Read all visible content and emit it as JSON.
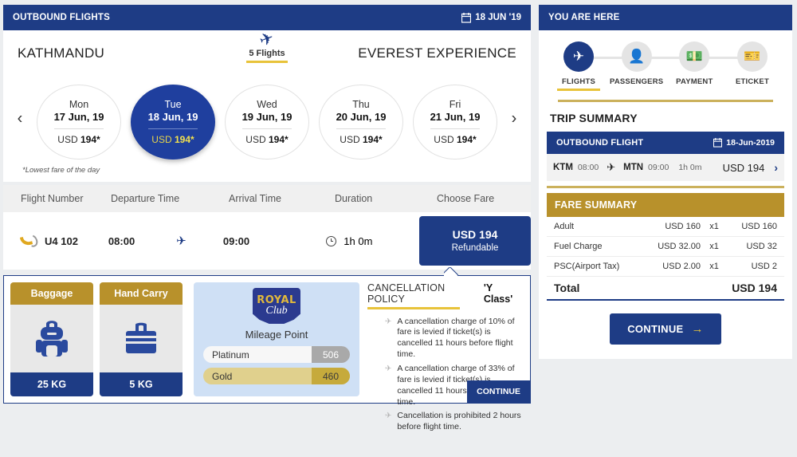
{
  "outbound": {
    "header_title": "OUTBOUND FLIGHTS",
    "header_date": "18 JUN '19",
    "calendar_icon": "calendar-icon",
    "origin": "KATHMANDU",
    "destination": "EVEREST EXPERIENCE",
    "flights_count": "5 Flights",
    "plane_icon": "airplane-icon",
    "prev_arrow": "‹",
    "next_arrow": "›",
    "lowest_fare_note": "*Lowest fare of the day",
    "days": [
      {
        "dow": "Mon",
        "date": "17 Jun, 19",
        "currency": "USD",
        "price": "194*",
        "selected": false
      },
      {
        "dow": "Tue",
        "date": "18 Jun, 19",
        "currency": "USD",
        "price": "194*",
        "selected": true
      },
      {
        "dow": "Wed",
        "date": "19 Jun, 19",
        "currency": "USD",
        "price": "194*",
        "selected": false
      },
      {
        "dow": "Thu",
        "date": "20 Jun, 19",
        "currency": "USD",
        "price": "194*",
        "selected": false
      },
      {
        "dow": "Fri",
        "date": "21 Jun, 19",
        "currency": "USD",
        "price": "194*",
        "selected": false
      }
    ]
  },
  "flight_table": {
    "columns": [
      "Flight Number",
      "Departure Time",
      "Arrival Time",
      "Duration",
      "Choose Fare"
    ],
    "row": {
      "flight_number": "U4 102",
      "departure_time": "08:00",
      "arrival_time": "09:00",
      "duration": "1h 0m",
      "fare_amount": "USD 194",
      "fare_type": "Refundable"
    }
  },
  "details": {
    "baggage": {
      "title": "Baggage",
      "weight": "25 KG",
      "icon": "backpack-icon"
    },
    "hand_carry": {
      "title": "Hand Carry",
      "weight": "5 KG",
      "icon": "briefcase-icon"
    },
    "mileage": {
      "logo_top": "ROYAL",
      "logo_bottom": "Club",
      "title": "Mileage Point",
      "tiers": [
        {
          "name": "Platinum",
          "points": "506"
        },
        {
          "name": "Gold",
          "points": "460"
        }
      ]
    },
    "policy": {
      "title": "CANCELLATION POLICY",
      "class_badge": "'Y Class'",
      "items": [
        "A cancellation charge of 10% of fare is levied if ticket(s) is cancelled 11 hours before flight time.",
        "A cancellation charge of 33% of fare is levied if ticket(s) is cancelled 11 hours within flight time.",
        "Cancellation is prohibited 2 hours before flight time."
      ],
      "continue_label": "CONTINUE"
    }
  },
  "sidebar": {
    "you_are_here_title": "YOU ARE HERE",
    "steps": [
      {
        "label": "FLIGHTS",
        "icon": "airplane-icon",
        "active": true
      },
      {
        "label": "PASSENGERS",
        "icon": "person-icon",
        "active": false
      },
      {
        "label": "PAYMENT",
        "icon": "wallet-icon",
        "active": false
      },
      {
        "label": "ETICKET",
        "icon": "ticket-icon",
        "active": false
      }
    ],
    "trip_summary_title": "TRIP SUMMARY",
    "outbound_flight": {
      "title": "OUTBOUND FLIGHT",
      "date": "18-Jun-2019",
      "calendar_icon": "calendar-icon",
      "origin_code": "KTM",
      "origin_time": "08:00",
      "dest_code": "MTN",
      "dest_time": "09:00",
      "duration": "1h 0m",
      "price": "USD 194",
      "chevron": "›"
    },
    "fare_summary": {
      "title": "FARE SUMMARY",
      "rows": [
        {
          "label": "Adult",
          "unit": "USD 160",
          "qty": "x1",
          "amount": "USD 160"
        },
        {
          "label": "Fuel Charge",
          "unit": "USD 32.00",
          "qty": "x1",
          "amount": "USD 32"
        },
        {
          "label": "PSC(Airport Tax)",
          "unit": "USD 2.00",
          "qty": "x1",
          "amount": "USD 2"
        }
      ],
      "total_label": "Total",
      "total_amount": "USD 194"
    },
    "continue_label": "CONTINUE",
    "continue_arrow": "→"
  },
  "colors": {
    "brand_blue": "#1e3c85",
    "selected_blue": "#1f3f9e",
    "gold": "#b8912b",
    "yellow_accent": "#e8c33a",
    "page_bg": "#eceef0"
  }
}
